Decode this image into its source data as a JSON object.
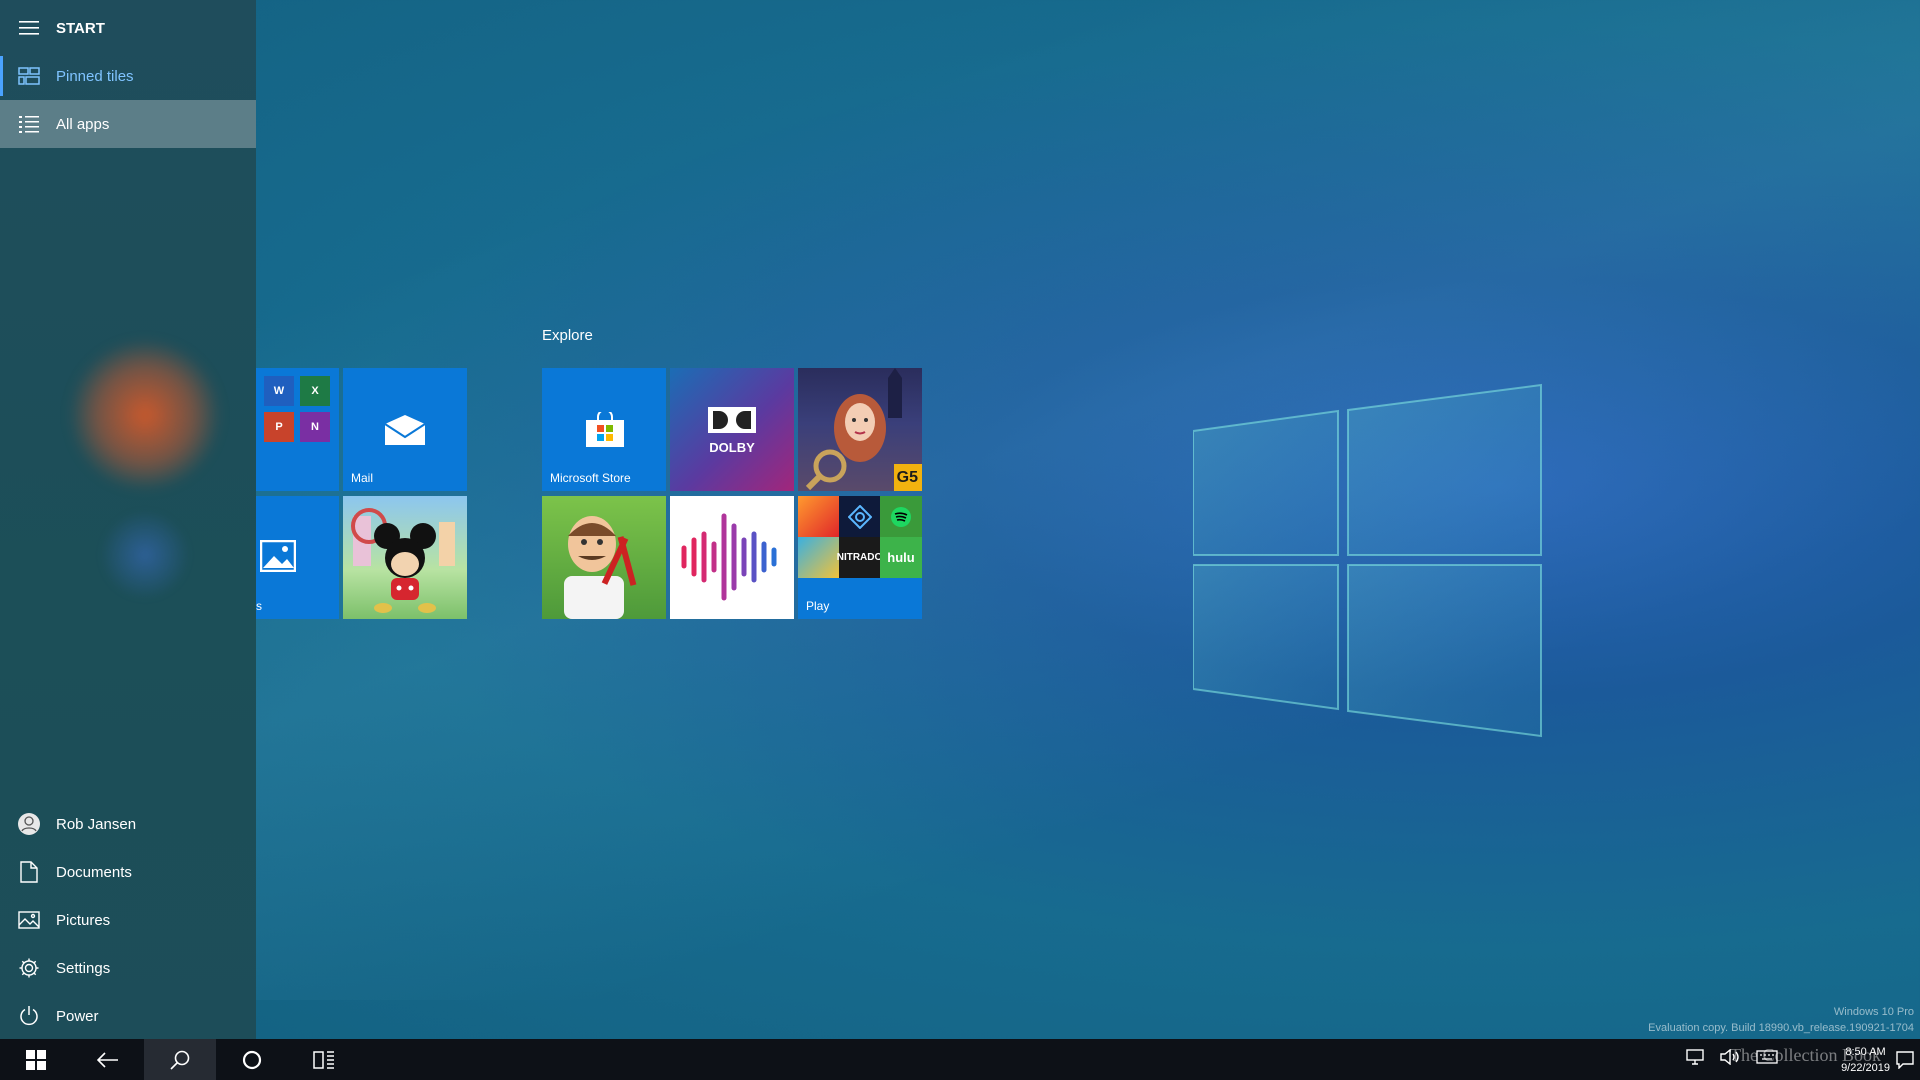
{
  "start_menu": {
    "title": "START",
    "nav": [
      {
        "label": "Pinned tiles",
        "icon": "tiles-icon",
        "active": true
      },
      {
        "label": "All apps",
        "icon": "list-icon"
      }
    ],
    "bottom": [
      {
        "label": "Rob Jansen",
        "icon": "user-icon"
      },
      {
        "label": "Documents",
        "icon": "document-icon"
      },
      {
        "label": "Pictures",
        "icon": "pictures-icon"
      },
      {
        "label": "Settings",
        "icon": "gear-icon"
      },
      {
        "label": "Power",
        "icon": "power-icon"
      }
    ]
  },
  "tiles": {
    "productivity": {
      "mail": "Mail",
      "photos_partial": "s",
      "office_icons": [
        "W",
        "X",
        "P",
        "N"
      ]
    },
    "explore": {
      "title": "Explore",
      "store": "Microsoft Store",
      "dolby": "DOLBY",
      "hidden_object_badge": "G5",
      "play": "Play",
      "play_apps": [
        "NITRADO",
        "hulu"
      ]
    }
  },
  "colors": {
    "tile_blue": "#0a78d7",
    "accent": "#4aa3ff",
    "taskbar": "#0d1117"
  },
  "taskbar": {
    "buttons": [
      "start-icon",
      "back-icon",
      "search-icon",
      "cortana-icon",
      "task-view-icon"
    ],
    "time": "8:50 AM",
    "date": "9/22/2019"
  },
  "watermark": {
    "line1": "Windows 10 Pro",
    "line2": "Evaluation copy. Build 18990.vb_release.190921-1704",
    "overlay": "The Collection Book"
  }
}
